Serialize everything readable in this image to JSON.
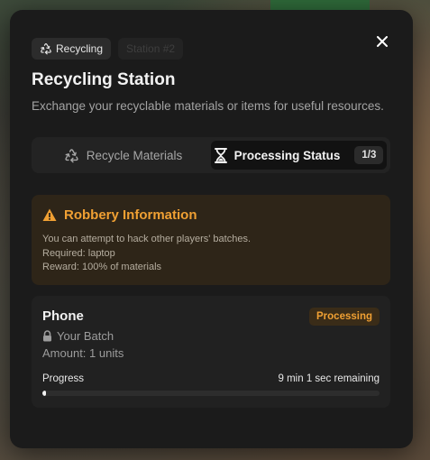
{
  "header": {
    "badge_primary": "Recycling",
    "badge_secondary": "Station #2",
    "title": "Recycling Station",
    "subtitle": "Exchange your recyclable materials or items for useful resources."
  },
  "tabs": [
    {
      "label": "Recycle Materials",
      "icon": "recycle-icon",
      "active": false
    },
    {
      "label": "Processing Status",
      "icon": "hourglass-icon",
      "active": true,
      "count": "1/3"
    }
  ],
  "robbery": {
    "title": "Robbery Information",
    "icon": "warning-icon",
    "lines": [
      "You can attempt to hack other players' batches.",
      "Required: laptop",
      "Reward: 100% of materials"
    ]
  },
  "batch": {
    "name": "Phone",
    "status": "Processing",
    "owner_icon": "lock-icon",
    "owner": "Your Batch",
    "amount": "Amount: 1 units",
    "progress_label": "Progress",
    "remaining": "9 min 1 sec remaining",
    "progress_percent": 1
  },
  "colors": {
    "accent": "#f0a033",
    "panel": "#1b1b1b"
  }
}
